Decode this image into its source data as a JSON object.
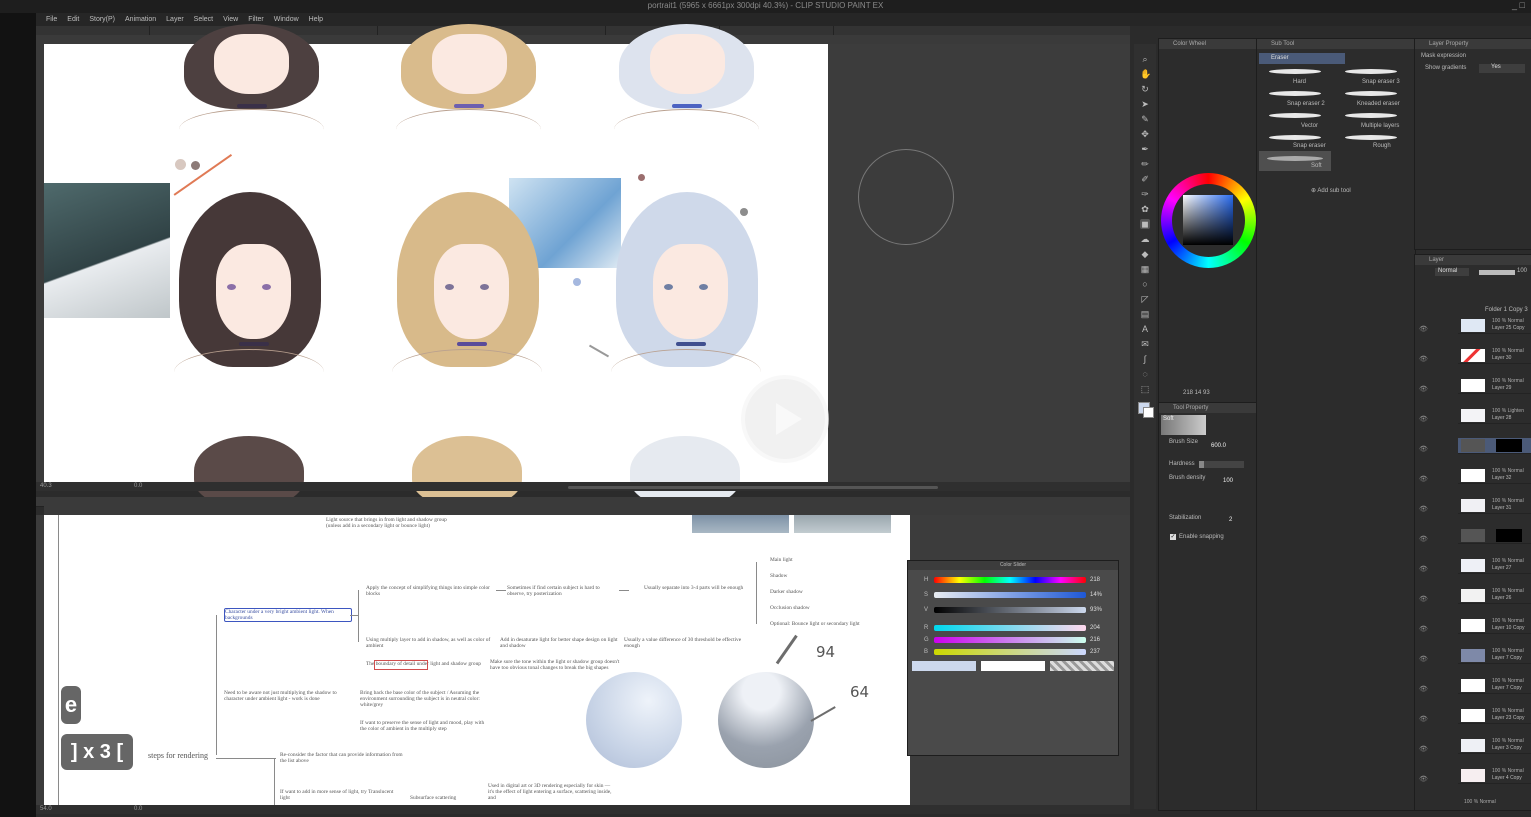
{
  "app": {
    "title": "portrait1 (5965 x 6661px 300dpi 40.3%) - CLIP STUDIO PAINT EX",
    "window_controls": "_ □"
  },
  "menu": [
    "File",
    "Edit",
    "Story(P)",
    "Animation",
    "Layer",
    "Select",
    "View",
    "Filter",
    "Window",
    "Help"
  ],
  "sub_tool": {
    "header": "Eraser",
    "tab": "Sub Tool",
    "brushes": [
      "Hard",
      "Snap eraser 3",
      "Snap eraser 2",
      "Kneaded eraser",
      "Vector",
      "Multiple layers",
      "Snap eraser",
      "Rough",
      "Soft"
    ],
    "add_label": "Add sub tool"
  },
  "color_wheel": {
    "tab": "Color Wheel",
    "readout": "218 14 93"
  },
  "tool_property": {
    "tab": "Tool Property",
    "tool_name": "Soft",
    "brush_size_label": "Brush Size",
    "brush_size_value": "600.0",
    "hardness_label": "Hardness",
    "brush_density_label": "Brush density",
    "brush_density_value": "100",
    "stabilization_label": "Stabilization",
    "stabilization_value": "2",
    "enable_snapping_label": "Enable snapping"
  },
  "layer_property": {
    "tab": "Layer Property",
    "mask_expression_label": "Mask expression",
    "show_gradients_label": "Show gradients",
    "show_gradients_value": "Yes"
  },
  "layers": {
    "tab": "Layer",
    "blend_mode": "Normal",
    "opacity": "100",
    "folder_name": "Folder 1 Copy 3",
    "items": [
      {
        "pct": "100 % Normal",
        "name": "Layer 25 Copy"
      },
      {
        "pct": "100 % Normal",
        "name": "Layer 30"
      },
      {
        "pct": "100 % Normal",
        "name": "Layer 29"
      },
      {
        "pct": "100 % Lighten",
        "name": "Layer 28"
      },
      {
        "pct": "",
        "name": ""
      },
      {
        "pct": "100 % Normal",
        "name": "Layer 32"
      },
      {
        "pct": "100 % Normal",
        "name": "Layer 31"
      },
      {
        "pct": "",
        "name": ""
      },
      {
        "pct": "100 % Normal",
        "name": "Layer 27"
      },
      {
        "pct": "100 % Normal",
        "name": "Layer 26"
      },
      {
        "pct": "100 % Normal",
        "name": "Layer 10 Copy"
      },
      {
        "pct": "100 % Normal",
        "name": "Layer 7 Copy"
      },
      {
        "pct": "100 % Normal",
        "name": "Layer 7 Copy"
      },
      {
        "pct": "100 % Normal",
        "name": "Layer 23 Copy"
      },
      {
        "pct": "100 % Normal",
        "name": "Layer 3 Copy"
      },
      {
        "pct": "100 % Normal",
        "name": "Layer 4 Copy"
      }
    ],
    "footer": "100 % Normal"
  },
  "color_slider": {
    "title": "Color Slider",
    "rows": [
      {
        "label": "H",
        "value": "218"
      },
      {
        "label": "S",
        "value": "14%"
      },
      {
        "label": "V",
        "value": "93%"
      },
      {
        "label": "R",
        "value": "204"
      },
      {
        "label": "G",
        "value": "216"
      },
      {
        "label": "B",
        "value": "237"
      }
    ]
  },
  "status": {
    "zoom_top": "40.3",
    "angle_top": "0.0",
    "zoom_bottom": "54.0",
    "angle_bottom": "0.0"
  },
  "mindmap": {
    "top_note": "Light source that brings in from light and shadow group (unless add in a secondary light or bounce light)",
    "character_note": "Character under a very bright ambient light. When backgrounds",
    "apply_note": "Apply the concept of simplifying things into simple color blocks",
    "sometimes_note": "Sometimes if find certain subject is hard to observe, try posterization",
    "usually_note": "Usually separate into 3-4 parts will be enough",
    "multiply_note": "Using multiply layer to add in shadow, as well as color of ambient",
    "add_note": "Add in desaturate light for better shape design on light and shadow",
    "usually_diff": "Usually a value difference of 30 threshold be effective enough",
    "red_note": "The boundary of detail under light and shadow group",
    "make_note": "Make sure the tone within the light or shadow group doesn't have too obvious tonal changes to break the big shapes",
    "need_note": "Need to be aware not just multiplying the shadow to character under ambient light - work is done",
    "bring_note": "Bring back the base color of the subject / Assuming the environment surrounding the subject is in neutral color: white/grey",
    "want_note": "If want to preserve the sense of light and mood, play with the color of ambient in the multiply step",
    "steps_label": "steps for rendering",
    "reconsider_note": "Re-consider the factor that can provide information from the list above",
    "want_add_note": "If want to add in more sense of light, try Translucent light",
    "subsurface_note": "Subsurface scattering",
    "used_note": "Used in digital art or 3D rendering especially for skin — it's the effect of light entering a surface, scattering inside, and",
    "light_list": [
      "Main light",
      "Shadow",
      "Darker shadow",
      "Occlusion shadow",
      "Optional: Bounce light or secondary light"
    ],
    "handwritten_94": "94",
    "handwritten_64": "64"
  },
  "overlay_keys": {
    "key1": "e",
    "key2": "] x 3 ["
  }
}
